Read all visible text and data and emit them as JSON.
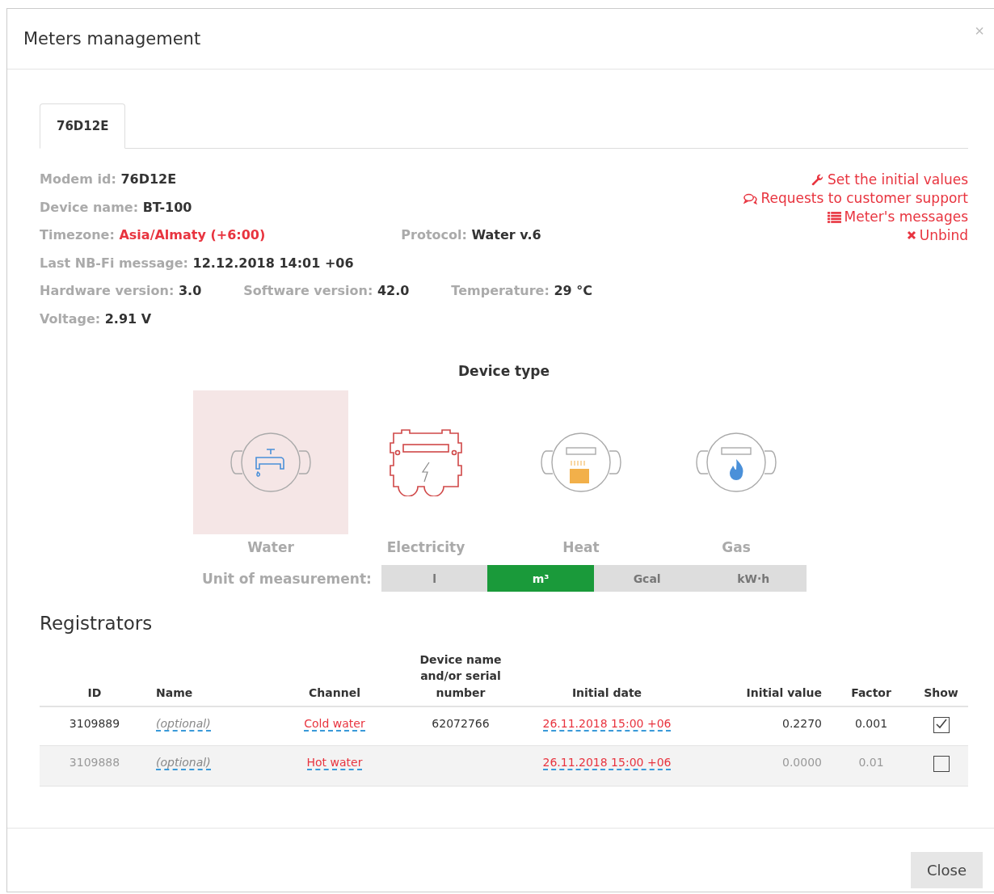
{
  "window": {
    "title": "Meters management",
    "close": "×"
  },
  "tabs": [
    {
      "label": "76D12E",
      "selected": true
    }
  ],
  "info_rows": [
    [
      {
        "label": "Modem id:",
        "value": "76D12E",
        "highlight": false
      }
    ],
    [
      {
        "label": "Device name:",
        "value": "BT-100",
        "highlight": false
      }
    ],
    [
      {
        "label": "Timezone:",
        "value": "Asia/Almaty (+6:00)",
        "highlight": true
      },
      {
        "label": "Protocol:",
        "value": "Water v.6",
        "highlight": false
      }
    ],
    [
      {
        "label": "Last NB-Fi message:",
        "value": "12.12.2018 14:01 +06",
        "highlight": false
      }
    ],
    [
      {
        "label": "Hardware version:",
        "value": "3.0",
        "highlight": false
      },
      {
        "label": "Software version:",
        "value": "42.0",
        "highlight": false
      },
      {
        "label": "Temperature:",
        "value": "29 °C",
        "highlight": false
      }
    ],
    [
      {
        "label": "Voltage:",
        "value": "2.91 V",
        "highlight": false
      }
    ]
  ],
  "actions": [
    {
      "kind": "wrench",
      "label": "Set the initial values"
    },
    {
      "kind": "comments",
      "label": "Requests to customer support"
    },
    {
      "kind": "list",
      "label": "Meter's messages"
    },
    {
      "kind": "remove",
      "label": "Unbind"
    }
  ],
  "device_type": {
    "title": "Device type",
    "types": [
      {
        "kind": "water",
        "label": "Water",
        "selected": true
      },
      {
        "kind": "electricity",
        "label": "Electricity",
        "selected": false
      },
      {
        "kind": "heat",
        "label": "Heat",
        "selected": false
      },
      {
        "kind": "gas",
        "label": "Gas",
        "selected": false
      }
    ]
  },
  "unit": {
    "label": "Unit of measurement:",
    "options": [
      {
        "label": "l",
        "selected": false
      },
      {
        "label": "m³",
        "selected": true
      },
      {
        "label": "Gcal",
        "selected": false
      },
      {
        "label": "kW·h",
        "selected": false
      }
    ]
  },
  "registrators": {
    "title": "Registrators",
    "columns": [
      "ID",
      "Name",
      "Channel",
      "Device name and/or serial number",
      "Initial date",
      "Initial value",
      "Factor",
      "Show"
    ],
    "rows": [
      {
        "id": "3109889",
        "name_placeholder": "(optional)",
        "channel": "Cold water",
        "serial": "62072766",
        "initial_date": "26.11.2018 15:00 +06",
        "initial_value": "0.2270",
        "factor": "0.001",
        "checked": true
      },
      {
        "id": "3109888",
        "name_placeholder": "(optional)",
        "channel": "Hot water",
        "serial": "",
        "initial_date": "26.11.2018 15:00 +06",
        "initial_value": "0.0000",
        "factor": "0.01",
        "checked": false
      }
    ]
  },
  "footer": {
    "close_button": "Close"
  }
}
